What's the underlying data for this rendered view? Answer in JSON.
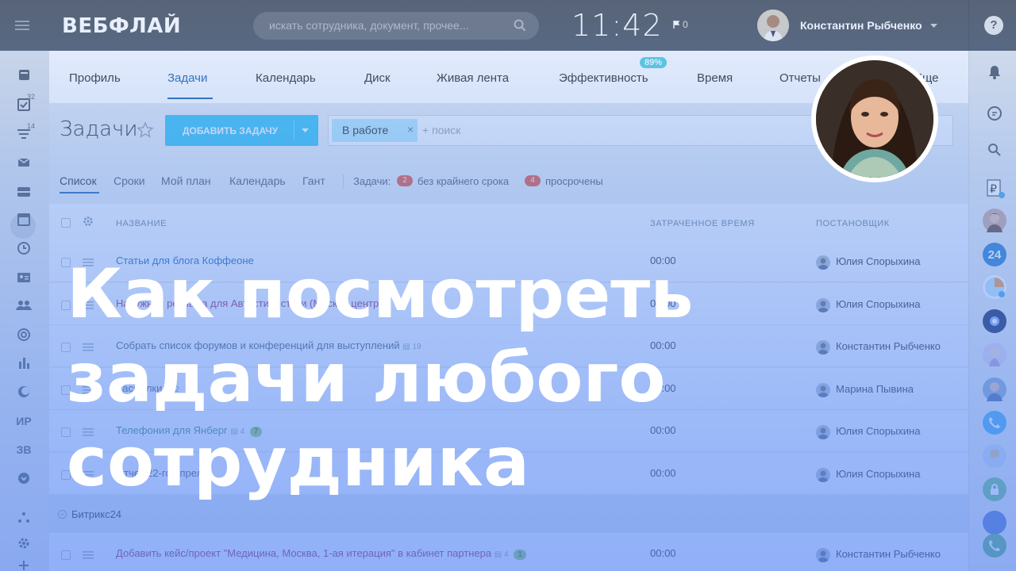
{
  "topbar": {
    "logo": "ВЕБФЛАЙ",
    "search_placeholder": "искать сотрудника, документ, прочее...",
    "clock": "11:42",
    "flag_count": "0",
    "user_name": "Константин Рыбченко",
    "help_label": "?"
  },
  "sidebar": {
    "badges": {
      "tasks": "32",
      "filters": "14"
    },
    "text_items": [
      "ИР",
      "ЗВ"
    ]
  },
  "nav": {
    "tabs": [
      "Профиль",
      "Задачи",
      "Календарь",
      "Диск",
      "Живая лента",
      "Эффективность",
      "Время",
      "Отчеты",
      "Еще"
    ],
    "efficiency_badge": "89%"
  },
  "toolbar": {
    "title": "Задачи",
    "add_button": "ДОБАВИТЬ ЗАДАЧУ",
    "filter_tag": "В работе",
    "filter_tag_close": "×",
    "filter_placeholder": "+ поиск"
  },
  "subnav": {
    "views": [
      "Список",
      "Сроки",
      "Мой план",
      "Календарь",
      "Гант"
    ],
    "counters_label": "Задачи:",
    "no_deadline_count": "2",
    "no_deadline_label": "без крайнего срока",
    "overdue_count": "4",
    "overdue_label": "просрочены"
  },
  "table": {
    "columns": [
      "НАЗВАНИЕ",
      "ЗАТРАЧЕННОЕ ВРЕМЯ",
      "ПОСТАНОВЩИК"
    ],
    "rows": [
      {
        "title": "Статьи для блога Коффеоне",
        "comments": "",
        "time": "00:00",
        "creator": "Юлия Спорыхина",
        "color": "#2067b0"
      },
      {
        "title": "Наружная реклама для Автостилистики (Москва центр)",
        "comments": "",
        "time": "00:00",
        "creator": "Юлия Спорыхина",
        "color": "#a0306a"
      },
      {
        "title": "Собрать список форумов и конференций для выступлений",
        "comments": "19",
        "time": "00:00",
        "creator": "Константин Рыбченко",
        "color": "#535c69"
      },
      {
        "title": "Рассылки",
        "comments": "2",
        "time": "00:00",
        "creator": "Марина Пывина",
        "color": "#535c69"
      },
      {
        "title": "Телефония для Янберг",
        "comments": "4",
        "badge": "7",
        "time": "00:00",
        "creator": "Юлия Спорыхина",
        "color": "#3f8f6a"
      },
      {
        "title": "Отчет 22-го апреля",
        "comments": "",
        "time": "00:00",
        "creator": "Юлия Спорыхина",
        "color": "#535c69"
      }
    ],
    "group_label": "Битрикс24",
    "group_row": {
      "title": "Добавить кейс/проект \"Медицина, Москва, 1-ая итерация\" в кабинет партнера",
      "comments": "4",
      "badge": "1",
      "time": "00:00",
      "creator": "Константин Рыбченко",
      "color": "#a0306a"
    }
  },
  "overlay": {
    "headline": [
      "Как посмотреть",
      "задачи любого",
      "сотрудника"
    ]
  },
  "colors": {
    "topbar": "#535c69",
    "accent": "#3bc8f5",
    "link": "#2067b0",
    "badge_red": "#f0553b",
    "overlay_blue": "#5a8cf5"
  }
}
